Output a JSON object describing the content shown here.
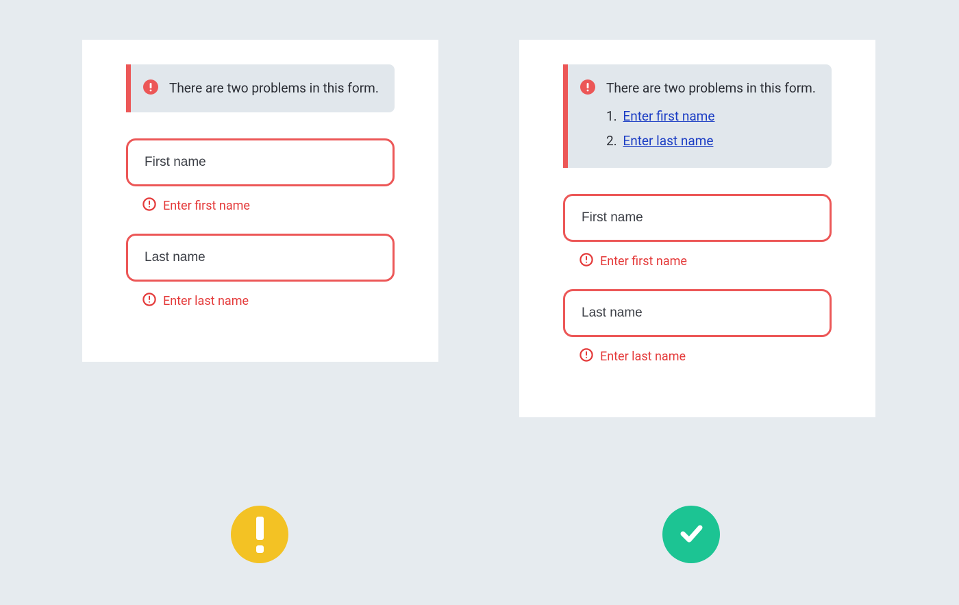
{
  "colors": {
    "danger": "#ec5757",
    "alert_bg": "#e1e7ec",
    "link": "#1b3dc4",
    "warn_badge": "#f3c224",
    "ok_badge": "#1cc493"
  },
  "left_example": {
    "alert_message": "There are two problems in this form.",
    "fields": [
      {
        "placeholder": "First name",
        "error": "Enter first name"
      },
      {
        "placeholder": "Last name",
        "error": "Enter last name"
      }
    ],
    "status": "warning"
  },
  "right_example": {
    "alert_message": "There are two problems in this form.",
    "error_links": [
      {
        "ordinal": "1.",
        "text": "Enter first name"
      },
      {
        "ordinal": "2.",
        "text": "Enter last name"
      }
    ],
    "fields": [
      {
        "placeholder": "First name",
        "error": "Enter first name"
      },
      {
        "placeholder": "Last name",
        "error": "Enter last name"
      }
    ],
    "status": "ok"
  }
}
